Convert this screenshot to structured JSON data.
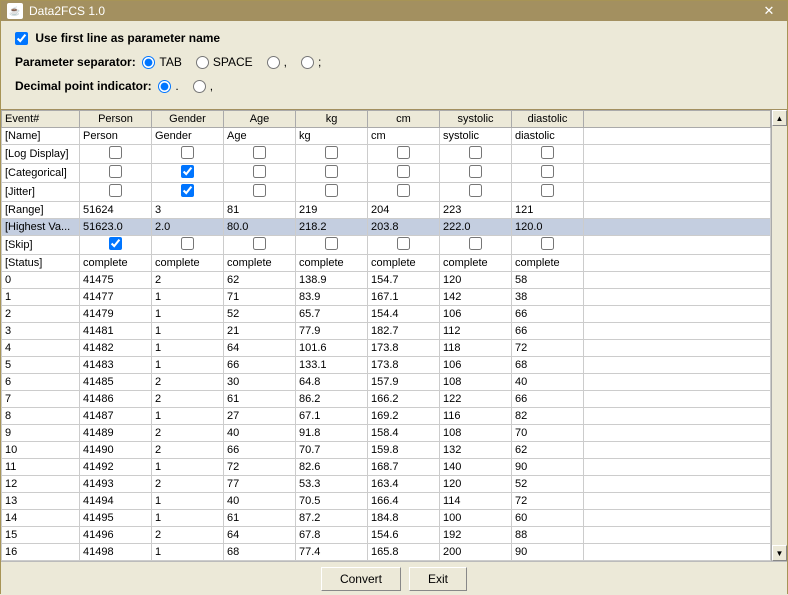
{
  "window": {
    "title": "Data2FCS 1.0",
    "close": "✕"
  },
  "options": {
    "use_first_line": "Use first line as parameter name",
    "use_first_line_checked": true,
    "sep_label": "Parameter separator:",
    "sep_tab": "TAB",
    "sep_space": "SPACE",
    "sep_comma": ",",
    "sep_semi": ";",
    "dec_label": "Decimal point indicator:",
    "dec_dot": ".",
    "dec_comma": ","
  },
  "headers": [
    "Event#",
    "Person",
    "Gender",
    "Age",
    "kg",
    "cm",
    "systolic",
    "diastolic"
  ],
  "meta_rows": [
    {
      "label": "[Name]",
      "type": "text",
      "vals": [
        "Person",
        "Gender",
        "Age",
        "kg",
        "cm",
        "systolic",
        "diastolic"
      ]
    },
    {
      "label": "[Log Display]",
      "type": "check",
      "vals": [
        false,
        false,
        false,
        false,
        false,
        false,
        false
      ]
    },
    {
      "label": "[Categorical]",
      "type": "check",
      "vals": [
        false,
        true,
        false,
        false,
        false,
        false,
        false
      ]
    },
    {
      "label": "[Jitter]",
      "type": "check",
      "vals": [
        false,
        true,
        false,
        false,
        false,
        false,
        false
      ]
    },
    {
      "label": "[Range]",
      "type": "text",
      "vals": [
        "51624",
        "3",
        "81",
        "219",
        "204",
        "223",
        "121"
      ]
    },
    {
      "label": "[Highest Va...",
      "type": "text",
      "vals": [
        "51623.0",
        "2.0",
        "80.0",
        "218.2",
        "203.8",
        "222.0",
        "120.0"
      ],
      "highlight": true
    },
    {
      "label": "[Skip]",
      "type": "check",
      "vals": [
        true,
        false,
        false,
        false,
        false,
        false,
        false
      ]
    },
    {
      "label": "[Status]",
      "type": "text",
      "vals": [
        "complete",
        "complete",
        "complete",
        "complete",
        "complete",
        "complete",
        "complete"
      ]
    }
  ],
  "data_rows": [
    [
      "0",
      "41475",
      "2",
      "62",
      "138.9",
      "154.7",
      "120",
      "58"
    ],
    [
      "1",
      "41477",
      "1",
      "71",
      "83.9",
      "167.1",
      "142",
      "38"
    ],
    [
      "2",
      "41479",
      "1",
      "52",
      "65.7",
      "154.4",
      "106",
      "66"
    ],
    [
      "3",
      "41481",
      "1",
      "21",
      "77.9",
      "182.7",
      "112",
      "66"
    ],
    [
      "4",
      "41482",
      "1",
      "64",
      "101.6",
      "173.8",
      "118",
      "72"
    ],
    [
      "5",
      "41483",
      "1",
      "66",
      "133.1",
      "173.8",
      "106",
      "68"
    ],
    [
      "6",
      "41485",
      "2",
      "30",
      "64.8",
      "157.9",
      "108",
      "40"
    ],
    [
      "7",
      "41486",
      "2",
      "61",
      "86.2",
      "166.2",
      "122",
      "66"
    ],
    [
      "8",
      "41487",
      "1",
      "27",
      "67.1",
      "169.2",
      "116",
      "82"
    ],
    [
      "9",
      "41489",
      "2",
      "40",
      "91.8",
      "158.4",
      "108",
      "70"
    ],
    [
      "10",
      "41490",
      "2",
      "66",
      "70.7",
      "159.8",
      "132",
      "62"
    ],
    [
      "11",
      "41492",
      "1",
      "72",
      "82.6",
      "168.7",
      "140",
      "90"
    ],
    [
      "12",
      "41493",
      "2",
      "77",
      "53.3",
      "163.4",
      "120",
      "52"
    ],
    [
      "13",
      "41494",
      "1",
      "40",
      "70.5",
      "166.4",
      "114",
      "72"
    ],
    [
      "14",
      "41495",
      "1",
      "61",
      "87.2",
      "184.8",
      "100",
      "60"
    ],
    [
      "15",
      "41496",
      "2",
      "64",
      "67.8",
      "154.6",
      "192",
      "88"
    ],
    [
      "16",
      "41498",
      "1",
      "68",
      "77.4",
      "165.8",
      "200",
      "90"
    ]
  ],
  "buttons": {
    "convert": "Convert",
    "exit": "Exit"
  },
  "scroll": {
    "up": "▲",
    "down": "▼"
  }
}
